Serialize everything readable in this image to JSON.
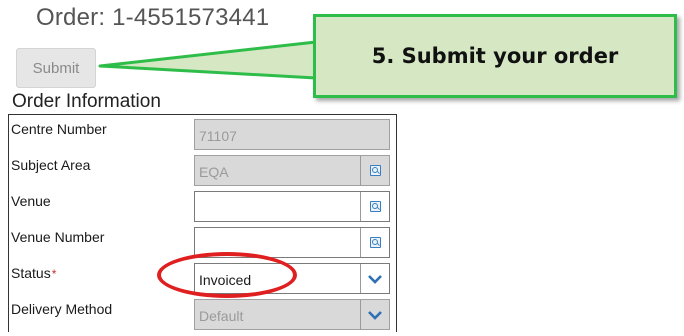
{
  "order": {
    "title": "Order: 1-4551573441"
  },
  "toolbar": {
    "submit_label": "Submit"
  },
  "section": {
    "title": "Order Information"
  },
  "fields": [
    {
      "label": "Centre Number",
      "value": "71107",
      "readonly": true,
      "required": false,
      "icon": "none"
    },
    {
      "label": "Subject Area",
      "value": "EQA",
      "readonly": true,
      "required": false,
      "icon": "lookup-icon"
    },
    {
      "label": "Venue",
      "value": "",
      "readonly": false,
      "required": false,
      "icon": "lookup-icon"
    },
    {
      "label": "Venue Number",
      "value": "",
      "readonly": false,
      "required": false,
      "icon": "lookup-icon"
    },
    {
      "label": "Status",
      "value": "Invoiced",
      "readonly": false,
      "required": true,
      "icon": "chevron-down-icon"
    },
    {
      "label": "Delivery Method",
      "value": "Default",
      "readonly": true,
      "required": false,
      "icon": "chevron-down-icon"
    }
  ],
  "required_marker": "*",
  "callout": {
    "text": "5. Submit your order"
  },
  "colors": {
    "callout_border": "#2fbd4a",
    "callout_fill": "#d5e8c3",
    "highlight_ellipse": "#e02020",
    "icon_blue": "#2f6fb5"
  }
}
